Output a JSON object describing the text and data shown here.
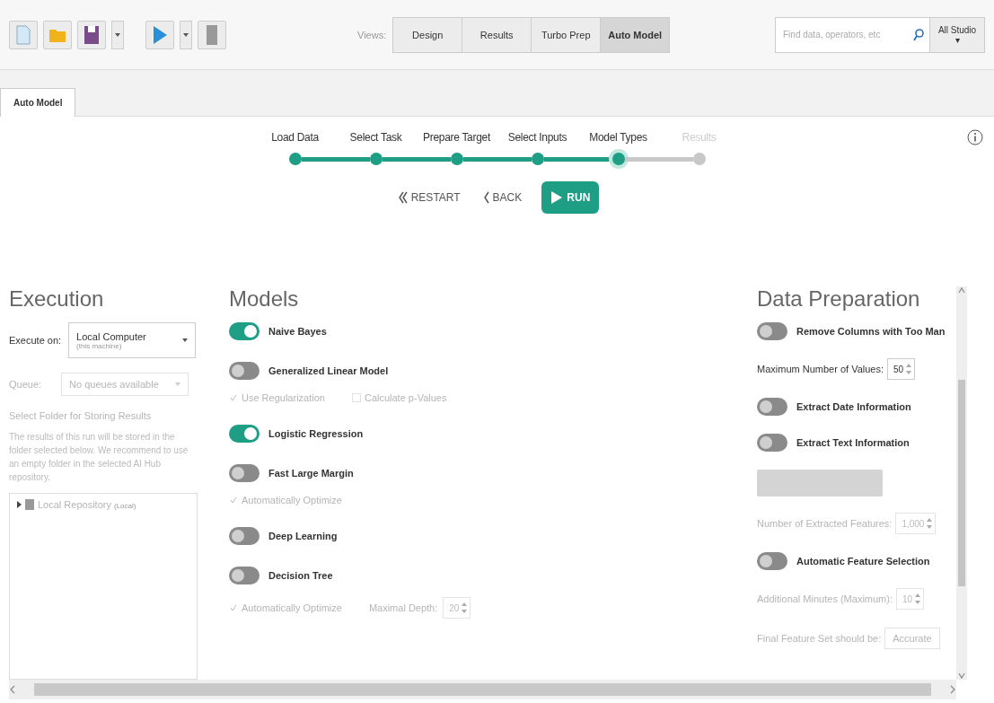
{
  "toolbar": {
    "views_label": "Views:",
    "views": [
      {
        "label": "Design",
        "selected": false
      },
      {
        "label": "Results",
        "selected": false
      },
      {
        "label": "Turbo Prep",
        "selected": false
      },
      {
        "label": "Auto Model",
        "selected": true
      }
    ],
    "search": {
      "placeholder": "Find data, operators, etc"
    },
    "scope": "All Studio ▾"
  },
  "tabs": [
    {
      "label": "Auto Model",
      "selected": true
    }
  ],
  "steps": [
    {
      "label": "Load Data",
      "completed": true,
      "selected": false
    },
    {
      "label": "Select Task",
      "completed": true,
      "selected": false
    },
    {
      "label": "Prepare Target",
      "completed": true,
      "selected": false
    },
    {
      "label": "Select Inputs",
      "completed": true,
      "selected": false
    },
    {
      "label": "Model Types",
      "completed": true,
      "selected": true
    },
    {
      "label": "Results",
      "completed": false,
      "selected": false
    }
  ],
  "actions": [
    {
      "label": "RESTART",
      "kind": "restart"
    },
    {
      "label": "BACK",
      "kind": "back"
    },
    {
      "label": "RUN",
      "kind": "run"
    }
  ],
  "execution": {
    "title": "Execution",
    "execute_label": "Execute on:",
    "execute_value": "Local Computer",
    "execute_sub": "(this machine)",
    "queue_label": "Queue:",
    "queue_placeholder": "No queues available",
    "folder_title": "Select Folder for Storing Results",
    "folder_text": "The results of this run will be stored in the folder selected below. We recommend to use an empty folder in the selected AI Hub repository.",
    "repository": "Local Repository",
    "repository_note": "(Local)"
  },
  "models": {
    "title": "Models",
    "items": [
      {
        "name": "Naive Bayes",
        "on": true
      },
      {
        "name": "Generalized Linear Model",
        "on": false,
        "options": [
          {
            "kind": "checkbox",
            "label": "Use Regularization",
            "checked": true
          },
          {
            "kind": "checkbox",
            "label": "Calculate p-Values",
            "checked": false
          }
        ]
      },
      {
        "name": "Logistic Regression",
        "on": true
      },
      {
        "name": "Fast Large Margin",
        "on": false,
        "options": [
          {
            "kind": "checkbox",
            "label": "Automatically Optimize",
            "checked": true
          }
        ]
      },
      {
        "name": "Deep Learning",
        "on": false
      },
      {
        "name": "Decision Tree",
        "on": false,
        "options": [
          {
            "kind": "checkbox",
            "label": "Automatically Optimize",
            "checked": true
          },
          {
            "kind": "spinner",
            "label": "Maximal Depth:",
            "value": "20"
          }
        ]
      }
    ]
  },
  "data_preparation": {
    "title": "Data Preparation",
    "items": [
      {
        "kind": "toggle",
        "label": "Remove Columns with Too Man",
        "on": false
      },
      {
        "kind": "spinner",
        "label": "Maximum Number of Values:",
        "value": "50",
        "disabled": false
      },
      {
        "kind": "toggle",
        "label": "Extract Date Information",
        "on": false
      },
      {
        "kind": "toggle",
        "label": "Extract Text Information",
        "on": false
      },
      {
        "kind": "button",
        "disabled": true
      },
      {
        "kind": "spinner",
        "label": "Number of Extracted Features:",
        "value": "1,000",
        "disabled": true
      },
      {
        "kind": "toggle",
        "label": "Automatic Feature Selection",
        "on": false
      },
      {
        "kind": "spinner",
        "label": "Additional Minutes (Maximum):",
        "value": "10",
        "disabled": true
      },
      {
        "kind": "select",
        "label": "Final Feature Set should be:",
        "value": "Accurate",
        "disabled": true
      }
    ]
  }
}
